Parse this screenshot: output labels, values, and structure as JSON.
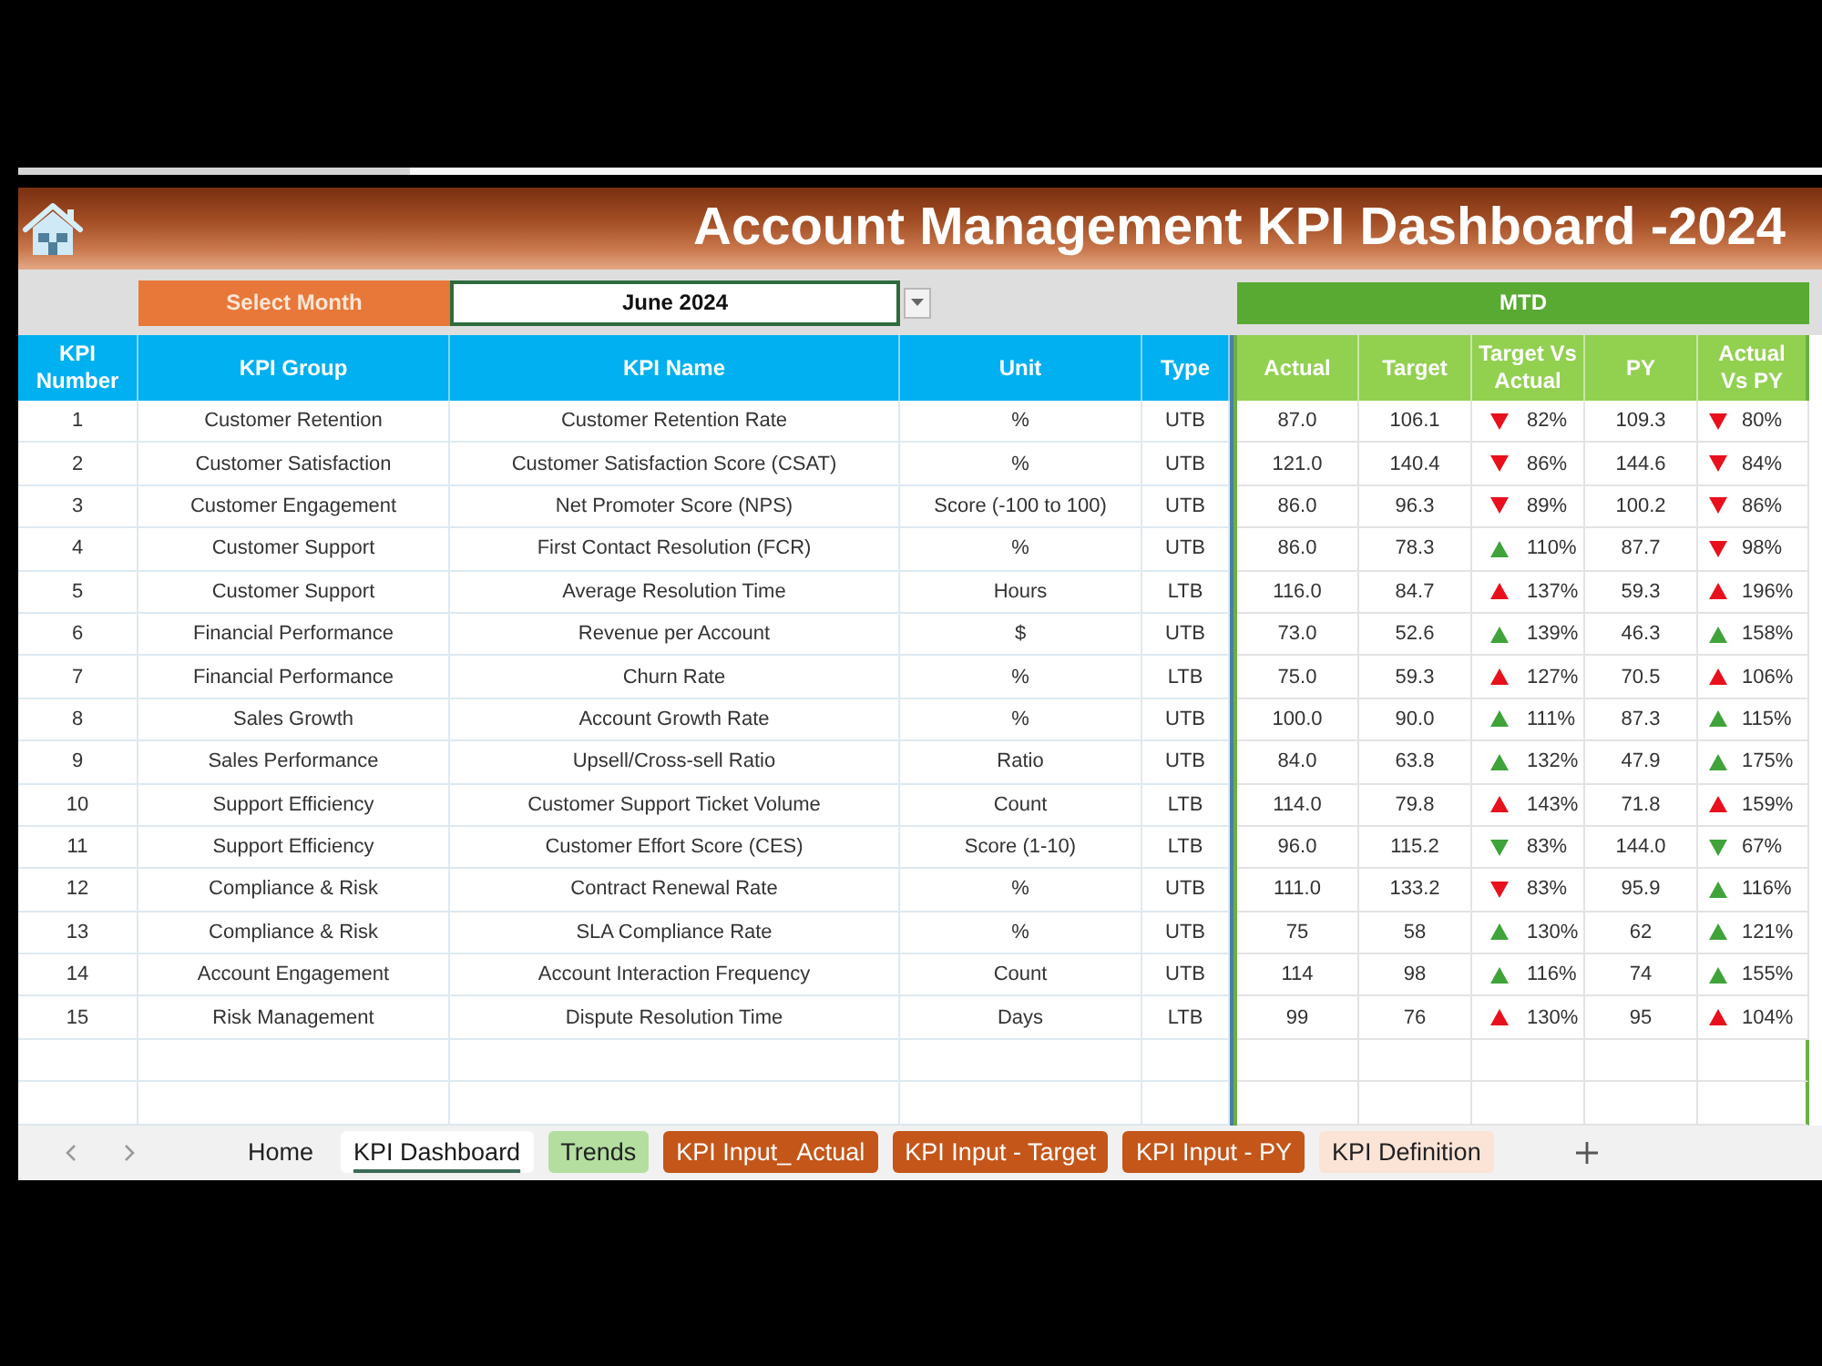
{
  "header": {
    "title": "Account Management KPI Dashboard -2024"
  },
  "month_selector": {
    "label": "Select Month",
    "value": "June 2024"
  },
  "mtd_band": {
    "label": "MTD"
  },
  "table": {
    "columns": [
      "KPI Number",
      "KPI Group",
      "KPI Name",
      "Unit",
      "Type"
    ],
    "mtd_columns": [
      "Actual",
      "Target",
      "Target Vs Actual",
      "PY",
      "Actual Vs PY"
    ],
    "rows": [
      {
        "number": "1",
        "group": "Customer Retention",
        "name": "Customer Retention Rate",
        "unit": "%",
        "type": "UTB",
        "actual": "87.0",
        "target": "106.1",
        "target_vs_actual": {
          "kind": "down",
          "color": "#e8101c",
          "value": "82%"
        },
        "py": "109.3",
        "actual_vs_py": {
          "kind": "down",
          "color": "#e8101c",
          "value": "80%"
        }
      },
      {
        "number": "2",
        "group": "Customer Satisfaction",
        "name": "Customer Satisfaction Score (CSAT)",
        "unit": "%",
        "type": "UTB",
        "actual": "121.0",
        "target": "140.4",
        "target_vs_actual": {
          "kind": "down",
          "color": "#e8101c",
          "value": "86%"
        },
        "py": "144.6",
        "actual_vs_py": {
          "kind": "down",
          "color": "#e8101c",
          "value": "84%"
        }
      },
      {
        "number": "3",
        "group": "Customer Engagement",
        "name": "Net Promoter Score (NPS)",
        "unit": "Score (-100 to 100)",
        "type": "UTB",
        "actual": "86.0",
        "target": "96.3",
        "target_vs_actual": {
          "kind": "down",
          "color": "#e8101c",
          "value": "89%"
        },
        "py": "100.2",
        "actual_vs_py": {
          "kind": "down",
          "color": "#e8101c",
          "value": "86%"
        }
      },
      {
        "number": "4",
        "group": "Customer Support",
        "name": "First Contact Resolution (FCR)",
        "unit": "%",
        "type": "UTB",
        "actual": "86.0",
        "target": "78.3",
        "target_vs_actual": {
          "kind": "up",
          "color": "#3fa33a",
          "value": "110%"
        },
        "py": "87.7",
        "actual_vs_py": {
          "kind": "down",
          "color": "#e8101c",
          "value": "98%"
        }
      },
      {
        "number": "5",
        "group": "Customer Support",
        "name": "Average Resolution Time",
        "unit": "Hours",
        "type": "LTB",
        "actual": "116.0",
        "target": "84.7",
        "target_vs_actual": {
          "kind": "up",
          "color": "#e8101c",
          "value": "137%"
        },
        "py": "59.3",
        "actual_vs_py": {
          "kind": "up",
          "color": "#e8101c",
          "value": "196%"
        }
      },
      {
        "number": "6",
        "group": "Financial Performance",
        "name": "Revenue per Account",
        "unit": "$",
        "type": "UTB",
        "actual": "73.0",
        "target": "52.6",
        "target_vs_actual": {
          "kind": "up",
          "color": "#3fa33a",
          "value": "139%"
        },
        "py": "46.3",
        "actual_vs_py": {
          "kind": "up",
          "color": "#3fa33a",
          "value": "158%"
        }
      },
      {
        "number": "7",
        "group": "Financial Performance",
        "name": "Churn Rate",
        "unit": "%",
        "type": "LTB",
        "actual": "75.0",
        "target": "59.3",
        "target_vs_actual": {
          "kind": "up",
          "color": "#e8101c",
          "value": "127%"
        },
        "py": "70.5",
        "actual_vs_py": {
          "kind": "up",
          "color": "#e8101c",
          "value": "106%"
        }
      },
      {
        "number": "8",
        "group": "Sales Growth",
        "name": "Account Growth Rate",
        "unit": "%",
        "type": "UTB",
        "actual": "100.0",
        "target": "90.0",
        "target_vs_actual": {
          "kind": "up",
          "color": "#3fa33a",
          "value": "111%"
        },
        "py": "87.3",
        "actual_vs_py": {
          "kind": "up",
          "color": "#3fa33a",
          "value": "115%"
        }
      },
      {
        "number": "9",
        "group": "Sales Performance",
        "name": "Upsell/Cross-sell Ratio",
        "unit": "Ratio",
        "type": "UTB",
        "actual": "84.0",
        "target": "63.8",
        "target_vs_actual": {
          "kind": "up",
          "color": "#3fa33a",
          "value": "132%"
        },
        "py": "47.9",
        "actual_vs_py": {
          "kind": "up",
          "color": "#3fa33a",
          "value": "175%"
        }
      },
      {
        "number": "10",
        "group": "Support Efficiency",
        "name": "Customer Support Ticket Volume",
        "unit": "Count",
        "type": "LTB",
        "actual": "114.0",
        "target": "79.8",
        "target_vs_actual": {
          "kind": "up",
          "color": "#e8101c",
          "value": "143%"
        },
        "py": "71.8",
        "actual_vs_py": {
          "kind": "up",
          "color": "#e8101c",
          "value": "159%"
        }
      },
      {
        "number": "11",
        "group": "Support Efficiency",
        "name": "Customer Effort Score (CES)",
        "unit": "Score (1-10)",
        "type": "LTB",
        "actual": "96.0",
        "target": "115.2",
        "target_vs_actual": {
          "kind": "down",
          "color": "#3fa33a",
          "value": "83%"
        },
        "py": "144.0",
        "actual_vs_py": {
          "kind": "down",
          "color": "#3fa33a",
          "value": "67%"
        }
      },
      {
        "number": "12",
        "group": "Compliance & Risk",
        "name": "Contract Renewal Rate",
        "unit": "%",
        "type": "UTB",
        "actual": "111.0",
        "target": "133.2",
        "target_vs_actual": {
          "kind": "down",
          "color": "#e8101c",
          "value": "83%"
        },
        "py": "95.9",
        "actual_vs_py": {
          "kind": "up",
          "color": "#3fa33a",
          "value": "116%"
        }
      },
      {
        "number": "13",
        "group": "Compliance & Risk",
        "name": "SLA Compliance Rate",
        "unit": "%",
        "type": "UTB",
        "actual": "75",
        "target": "58",
        "target_vs_actual": {
          "kind": "up",
          "color": "#3fa33a",
          "value": "130%"
        },
        "py": "62",
        "actual_vs_py": {
          "kind": "up",
          "color": "#3fa33a",
          "value": "121%"
        }
      },
      {
        "number": "14",
        "group": "Account Engagement",
        "name": "Account Interaction Frequency",
        "unit": "Count",
        "type": "UTB",
        "actual": "114",
        "target": "98",
        "target_vs_actual": {
          "kind": "up",
          "color": "#3fa33a",
          "value": "116%"
        },
        "py": "74",
        "actual_vs_py": {
          "kind": "up",
          "color": "#3fa33a",
          "value": "155%"
        }
      },
      {
        "number": "15",
        "group": "Risk Management",
        "name": "Dispute Resolution Time",
        "unit": "Days",
        "type": "LTB",
        "actual": "99",
        "target": "76",
        "target_vs_actual": {
          "kind": "up",
          "color": "#e8101c",
          "value": "130%"
        },
        "py": "95",
        "actual_vs_py": {
          "kind": "up",
          "color": "#e8101c",
          "value": "104%"
        }
      }
    ]
  },
  "sheet_tabs": [
    {
      "label": "Home",
      "selected": false
    },
    {
      "label": "KPI Dashboard",
      "selected": true
    },
    {
      "label": "Trends",
      "selected": false,
      "color": "#b3dea0"
    },
    {
      "label": "KPI Input_ Actual",
      "selected": false,
      "color": "#c4561a"
    },
    {
      "label": "KPI Input - Target",
      "selected": false,
      "color": "#c4561a"
    },
    {
      "label": "KPI Input - PY",
      "selected": false,
      "color": "#c4561a"
    },
    {
      "label": "KPI Definition",
      "selected": false,
      "color": "#fbe3d6"
    }
  ]
}
